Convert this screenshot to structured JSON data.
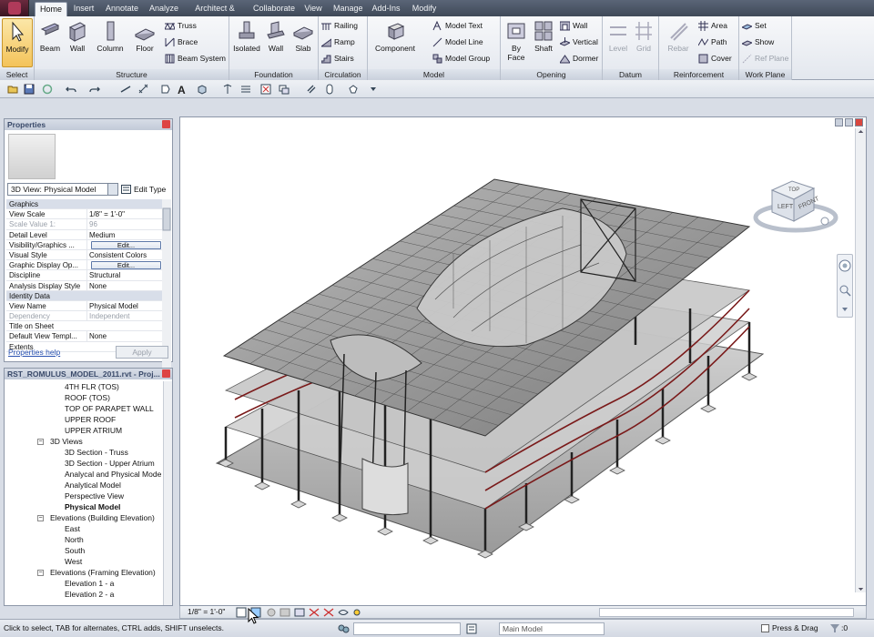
{
  "tabs": [
    "Home",
    "Insert",
    "Annotate",
    "Analyze",
    "Architect & Site",
    "Collaborate",
    "View",
    "Manage",
    "Add-Ins",
    "Modify"
  ],
  "ribbon": {
    "select": {
      "modify": "Modify",
      "title": "Select"
    },
    "structure": {
      "beam": "Beam",
      "wall": "Wall",
      "column": "Column",
      "floor": "Floor",
      "truss": "Truss",
      "brace": "Brace",
      "beam_system": "Beam System",
      "title": "Structure"
    },
    "foundation": {
      "isolated": "Isolated",
      "wall": "Wall",
      "slab": "Slab",
      "title": "Foundation"
    },
    "circulation": {
      "railing": "Railing",
      "ramp": "Ramp",
      "stairs": "Stairs",
      "title": "Circulation"
    },
    "model": {
      "component": "Component",
      "model_text": "Model Text",
      "model_line": "Model Line",
      "model_group": "Model Group",
      "title": "Model"
    },
    "opening": {
      "by_face": "By Face",
      "shaft": "Shaft",
      "wall": "Wall",
      "vertical": "Vertical",
      "dormer": "Dormer",
      "title": "Opening"
    },
    "datum": {
      "level": "Level",
      "grid": "Grid",
      "title": "Datum"
    },
    "reinforcement": {
      "rebar": "Rebar",
      "area": "Area",
      "path": "Path",
      "cover": "Cover",
      "title": "Reinforcement"
    },
    "work_plane": {
      "set": "Set",
      "show": "Show",
      "ref_plane": "Ref Plane",
      "title": "Work Plane"
    }
  },
  "properties": {
    "title": "Properties",
    "type_selector": "3D View: Physical Model",
    "edit_type": "Edit Type",
    "rows": [
      {
        "k": "Graphics",
        "v": "",
        "group": true
      },
      {
        "k": "View Scale",
        "v": "1/8\" = 1'-0\""
      },
      {
        "k": "Scale Value    1:",
        "v": "96",
        "disabled": true
      },
      {
        "k": "Detail Level",
        "v": "Medium"
      },
      {
        "k": "Visibility/Graphics ...",
        "v": "Edit...",
        "button": true
      },
      {
        "k": "Visual Style",
        "v": "Consistent Colors"
      },
      {
        "k": "Graphic Display Op...",
        "v": "Edit...",
        "button": true
      },
      {
        "k": "Discipline",
        "v": "Structural"
      },
      {
        "k": "Analysis Display Style",
        "v": "None"
      },
      {
        "k": "Identity Data",
        "v": "",
        "group": true
      },
      {
        "k": "View Name",
        "v": "Physical Model"
      },
      {
        "k": "Dependency",
        "v": "Independent",
        "disabled": true
      },
      {
        "k": "Title on Sheet",
        "v": ""
      },
      {
        "k": "Default View Templ...",
        "v": "None"
      },
      {
        "k": "Extents",
        "v": ""
      }
    ],
    "help": "Properties help",
    "apply": "Apply"
  },
  "browser": {
    "title": "RST_ROMULUS_MODEL_2011.rvt - Proj...",
    "items": [
      {
        "label": "4TH FLR (TOS)",
        "level": 3
      },
      {
        "label": "ROOF (TOS)",
        "level": 3
      },
      {
        "label": "TOP OF PARAPET WALL",
        "level": 3
      },
      {
        "label": "UPPER ROOF",
        "level": 3
      },
      {
        "label": "UPPER ATRIUM",
        "level": 3
      },
      {
        "label": "3D Views",
        "level": 2,
        "toggle": "−"
      },
      {
        "label": "3D Section - Truss",
        "level": 3
      },
      {
        "label": "3D Section - Upper Atrium",
        "level": 3
      },
      {
        "label": "Analycal and Physical Mode",
        "level": 3
      },
      {
        "label": "Analytical Model",
        "level": 3
      },
      {
        "label": "Perspective View",
        "level": 3
      },
      {
        "label": "Physical Model",
        "level": 3,
        "bold": true
      },
      {
        "label": "Elevations (Building Elevation)",
        "level": 2,
        "toggle": "−"
      },
      {
        "label": "East",
        "level": 3
      },
      {
        "label": "North",
        "level": 3
      },
      {
        "label": "South",
        "level": 3
      },
      {
        "label": "West",
        "level": 3
      },
      {
        "label": "Elevations (Framing Elevation)",
        "level": 2,
        "toggle": "−"
      },
      {
        "label": "Elevation 1 - a",
        "level": 3
      },
      {
        "label": "Elevation 2 - a",
        "level": 3
      }
    ]
  },
  "viewcube": {
    "left": "LEFT",
    "front": "FRONT",
    "top": "TOP"
  },
  "view_footer": {
    "scale": "1/8\" = 1'-0\""
  },
  "status": {
    "text": "Click to select, TAB for alternates, CTRL adds, SHIFT unselects.",
    "model": "Main Model",
    "press_drag": "Press & Drag",
    "filter_count": ":0"
  }
}
